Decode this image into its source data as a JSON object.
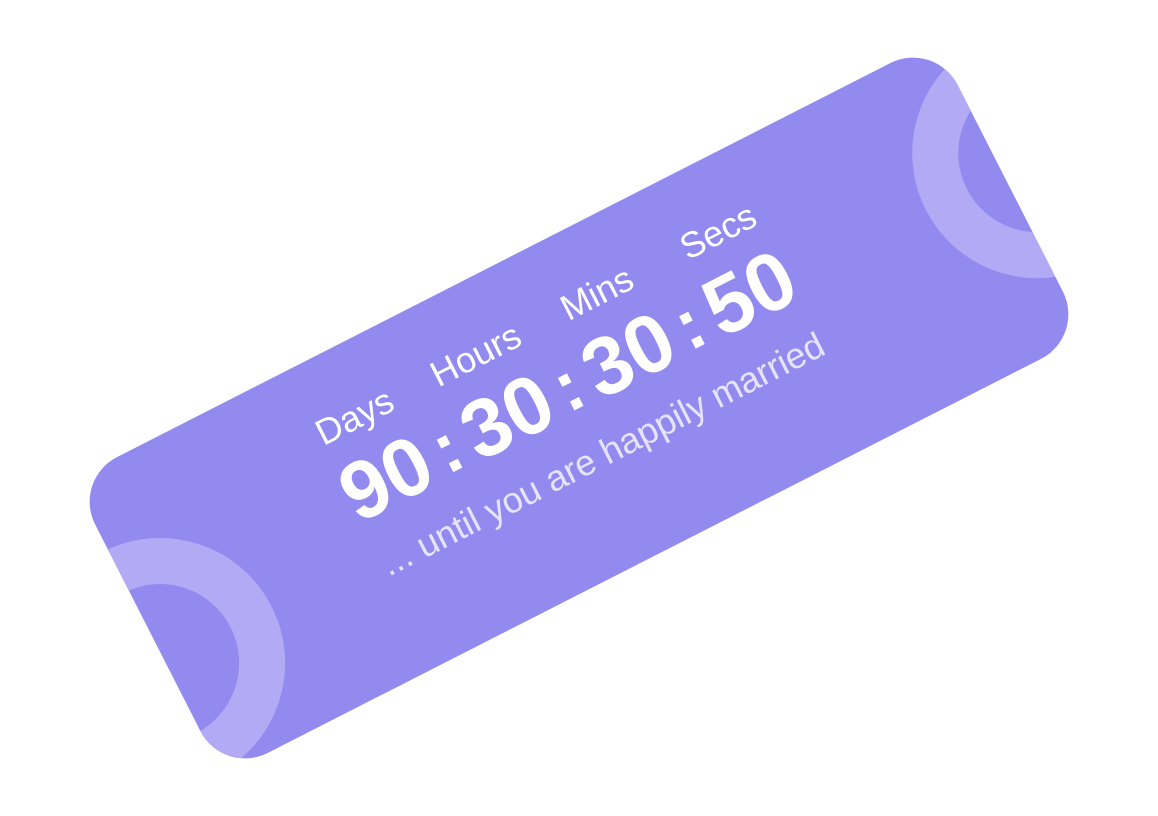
{
  "countdown": {
    "units": [
      {
        "label": "Days",
        "value": "90"
      },
      {
        "label": "Hours",
        "value": "30"
      },
      {
        "label": "Mins",
        "value": "30"
      },
      {
        "label": "Secs",
        "value": "50"
      }
    ],
    "separator": ":",
    "tagline": "... until you are happily married"
  },
  "colors": {
    "card_background": "#938AF0",
    "ring": "#B2AAF5",
    "text": "#FFFFFF",
    "tagline_text": "#E6E3FC"
  }
}
